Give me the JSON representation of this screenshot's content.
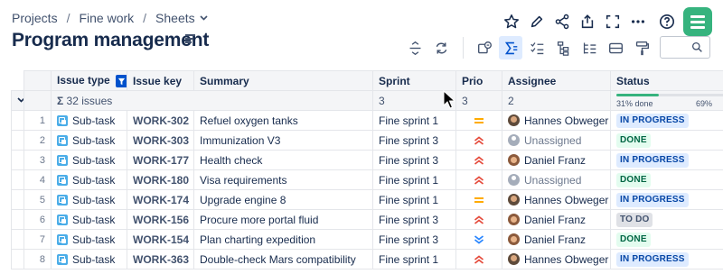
{
  "breadcrumb": {
    "items": [
      "Projects",
      "Fine work",
      "Sheets"
    ],
    "separator": "/"
  },
  "page_title": "Program management",
  "top_actions": [
    "star-icon",
    "edit-icon",
    "share-icon",
    "export-icon",
    "fullscreen-icon",
    "more-icon",
    "help-icon",
    "app-logo"
  ],
  "toolbar": {
    "buttons": [
      "expand-collapse-icon",
      "refresh-icon",
      "filter-view-icon",
      "sum-icon",
      "checklist-icon",
      "hierarchy-icon",
      "hierarchy-list-icon",
      "rows-icon",
      "paint-format-icon"
    ],
    "active": "sum-icon"
  },
  "search": {
    "value": "",
    "placeholder": ""
  },
  "columns": [
    "Issue type",
    "Issue key",
    "Summary",
    "Sprint",
    "Prio",
    "Assignee",
    "Status"
  ],
  "summary_row": {
    "sigma": "Σ",
    "issues": "32 issues",
    "sprint": "3",
    "prio": "3",
    "assignee": "2",
    "status_progress_fraction": 0.31,
    "status_left": "31% done",
    "status_right": "69%"
  },
  "rows": [
    {
      "num": "1",
      "type": "Sub-task",
      "key": "WORK-302",
      "summary": "Refuel oxygen tanks",
      "sprint": "Fine sprint 1",
      "prio": "medium",
      "assignee": "Hannes Obweger",
      "assignee_kind": "person",
      "status": "IN PROGRESS",
      "status_kind": "prog"
    },
    {
      "num": "2",
      "type": "Sub-task",
      "key": "WORK-303",
      "summary": "Immunization V3",
      "sprint": "Fine sprint 3",
      "prio": "high",
      "assignee": "Unassigned",
      "assignee_kind": "unassigned",
      "status": "DONE",
      "status_kind": "done"
    },
    {
      "num": "3",
      "type": "Sub-task",
      "key": "WORK-177",
      "summary": "Health check",
      "sprint": "Fine sprint 3",
      "prio": "high",
      "assignee": "Daniel Franz",
      "assignee_kind": "person2",
      "status": "IN PROGRESS",
      "status_kind": "prog"
    },
    {
      "num": "4",
      "type": "Sub-task",
      "key": "WORK-180",
      "summary": "Visa requirements",
      "sprint": "Fine sprint 1",
      "prio": "high",
      "assignee": "Unassigned",
      "assignee_kind": "unassigned",
      "status": "DONE",
      "status_kind": "done"
    },
    {
      "num": "5",
      "type": "Sub-task",
      "key": "WORK-174",
      "summary": "Upgrade engine 8",
      "sprint": "Fine sprint 1",
      "prio": "medium",
      "assignee": "Hannes Obweger",
      "assignee_kind": "person",
      "status": "IN PROGRESS",
      "status_kind": "prog"
    },
    {
      "num": "6",
      "type": "Sub-task",
      "key": "WORK-156",
      "summary": "Procure more portal fluid",
      "sprint": "Fine sprint 3",
      "prio": "high",
      "assignee": "Daniel Franz",
      "assignee_kind": "person2",
      "status": "TO DO",
      "status_kind": "todo"
    },
    {
      "num": "7",
      "type": "Sub-task",
      "key": "WORK-154",
      "summary": "Plan charting expedition",
      "sprint": "Fine sprint 3",
      "prio": "low",
      "assignee": "Daniel Franz",
      "assignee_kind": "person2",
      "status": "DONE",
      "status_kind": "done"
    },
    {
      "num": "8",
      "type": "Sub-task",
      "key": "WORK-363",
      "summary": "Double-check Mars compatibility",
      "sprint": "Fine sprint 1",
      "prio": "high",
      "assignee": "Hannes Obweger",
      "assignee_kind": "person",
      "status": "IN PROGRESS",
      "status_kind": "prog"
    }
  ],
  "colors": {
    "accent": "#0052cc",
    "done": "#36b37e",
    "prio_high": "#e5493a",
    "prio_medium": "#ffab00",
    "prio_low": "#2684ff"
  }
}
